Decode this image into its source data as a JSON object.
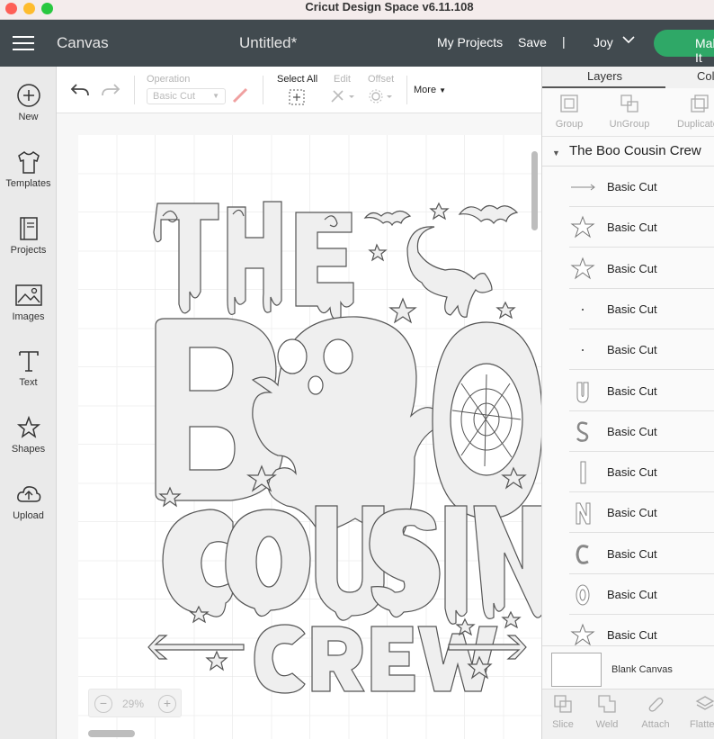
{
  "window": {
    "title": "Cricut Design Space  v6.11.108"
  },
  "header": {
    "section": "Canvas",
    "document_title": "Untitled*",
    "my_projects": "My Projects",
    "save": "Save",
    "separator": "|",
    "user": "Joy",
    "make_it": "Make It"
  },
  "left_nav": [
    {
      "label": "New",
      "icon": "plus-circle-icon"
    },
    {
      "label": "Templates",
      "icon": "shirt-icon"
    },
    {
      "label": "Projects",
      "icon": "book-icon"
    },
    {
      "label": "Images",
      "icon": "image-icon"
    },
    {
      "label": "Text",
      "icon": "text-icon"
    },
    {
      "label": "Shapes",
      "icon": "shapes-icon"
    },
    {
      "label": "Upload",
      "icon": "cloud-upload-icon"
    }
  ],
  "toolbar": {
    "operation_label": "Operation",
    "operation_value": "Basic Cut",
    "select_all": "Select All",
    "edit": "Edit",
    "offset": "Offset",
    "more": "More"
  },
  "canvas": {
    "zoom": "29%",
    "zoom_minus": "−",
    "zoom_plus": "+"
  },
  "design": {
    "line1": "THE",
    "line2": [
      "B",
      "O"
    ],
    "line3": "COUSIN",
    "line4": "CREW"
  },
  "panel": {
    "tabs": [
      "Layers",
      "Color Sync"
    ],
    "tools": [
      "Group",
      "UnGroup",
      "Duplicate"
    ],
    "group_name": "The Boo Cousin Crew",
    "layers": [
      {
        "name": "Basic Cut",
        "thumb": "arrow-thumb-icon"
      },
      {
        "name": "Basic Cut",
        "thumb": "star-thumb-icon"
      },
      {
        "name": "Basic Cut",
        "thumb": "star-thumb-icon"
      },
      {
        "name": "Basic Cut",
        "thumb": "dot-thumb-icon"
      },
      {
        "name": "Basic Cut",
        "thumb": "dot-thumb-icon"
      },
      {
        "name": "Basic Cut",
        "thumb": "letter-u-thumb-icon"
      },
      {
        "name": "Basic Cut",
        "thumb": "letter-s-thumb-icon"
      },
      {
        "name": "Basic Cut",
        "thumb": "letter-i-thumb-icon"
      },
      {
        "name": "Basic Cut",
        "thumb": "letter-n-thumb-icon"
      },
      {
        "name": "Basic Cut",
        "thumb": "letter-c-thumb-icon"
      },
      {
        "name": "Basic Cut",
        "thumb": "letter-o-thumb-icon"
      },
      {
        "name": "Basic Cut",
        "thumb": "star-thumb-icon"
      }
    ],
    "blank_canvas": "Blank Canvas",
    "bottom_tools": [
      "Slice",
      "Weld",
      "Attach",
      "Flatten"
    ]
  },
  "colors": {
    "appbar": "#414a4f",
    "make_it": "#2fa867",
    "canvas_bg": "#f7f7f7",
    "design_fill": "#efefef",
    "design_stroke": "#555555"
  }
}
